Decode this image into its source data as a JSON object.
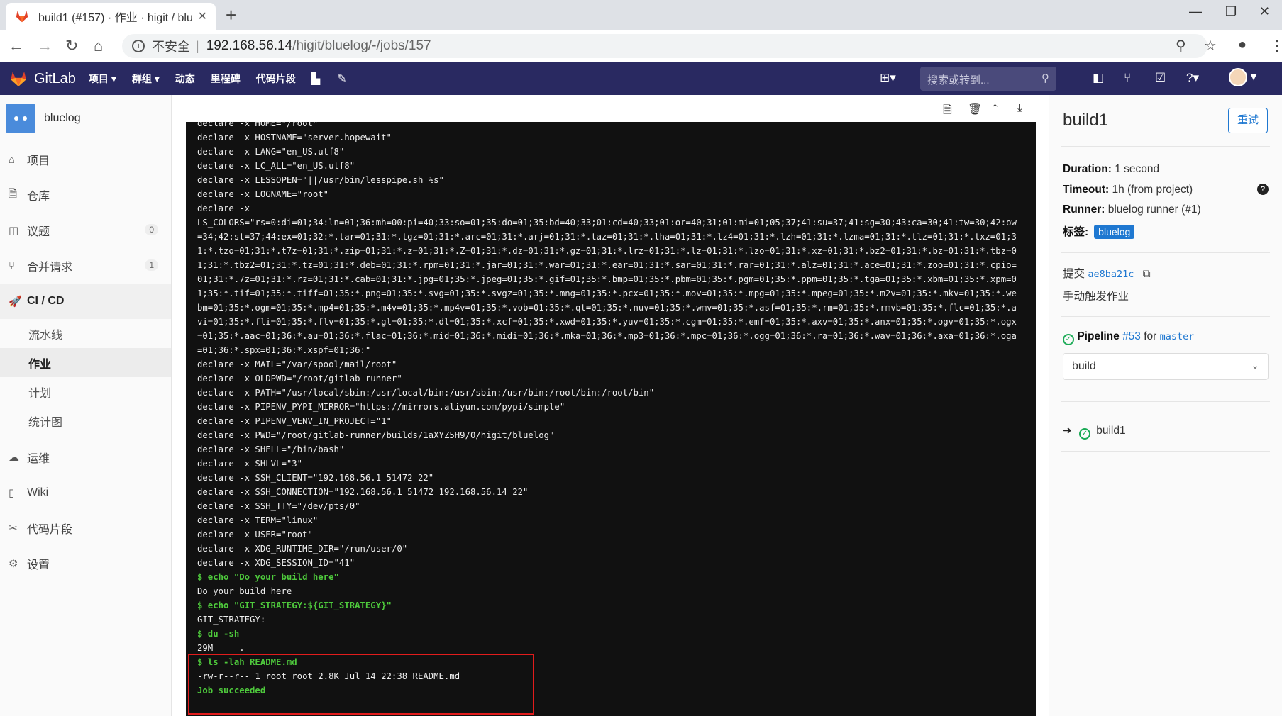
{
  "browser": {
    "tab_title": "build1 (#157) · 作业 · higit / blu",
    "url_insecure": "不安全",
    "url_host": "192.168.56.14",
    "url_path": "/higit/bluelog/-/jobs/157"
  },
  "header": {
    "brand": "GitLab",
    "nav": [
      "项目 ▾",
      "群组 ▾",
      "动态",
      "里程碑",
      "代码片段"
    ],
    "search_placeholder": "搜索或转到..."
  },
  "sidebar": {
    "project": "bluelog",
    "items": [
      {
        "label": "项目",
        "icon": "home-icon"
      },
      {
        "label": "仓库",
        "icon": "doc-icon"
      },
      {
        "label": "议题",
        "icon": "issues-icon",
        "count": "0"
      },
      {
        "label": "合并请求",
        "icon": "merge-icon",
        "count": "1"
      },
      {
        "label": "CI / CD",
        "icon": "rocket-icon"
      },
      {
        "label": "运维",
        "icon": "cloud-icon"
      },
      {
        "label": "Wiki",
        "icon": "book-icon"
      },
      {
        "label": "代码片段",
        "icon": "scissors-icon"
      },
      {
        "label": "设置",
        "icon": "gear-icon"
      }
    ],
    "cicd_sub": [
      "流水线",
      "作业",
      "计划",
      "统计图"
    ]
  },
  "log": {
    "lines": [
      {
        "t": "declare -x HOME=\"/root\"",
        "c": "w"
      },
      {
        "t": "declare -x HOSTNAME=\"server.hopewait\"",
        "c": "w"
      },
      {
        "t": "declare -x LANG=\"en_US.utf8\"",
        "c": "w"
      },
      {
        "t": "declare -x LC_ALL=\"en_US.utf8\"",
        "c": "w"
      },
      {
        "t": "declare -x LESSOPEN=\"||/usr/bin/lesspipe.sh %s\"",
        "c": "w"
      },
      {
        "t": "declare -x LOGNAME=\"root\"",
        "c": "w"
      },
      {
        "t": "declare -x",
        "c": "w"
      },
      {
        "t": "LS_COLORS=\"rs=0:di=01;34:ln=01;36:mh=00:pi=40;33:so=01;35:do=01;35:bd=40;33;01:cd=40;33;01:or=40;31;01:mi=01;05;37;41:su=37;41:sg=30;43:ca=30;41:tw=30;42:ow",
        "c": "w"
      },
      {
        "t": "=34;42:st=37;44:ex=01;32:*.tar=01;31:*.tgz=01;31:*.arc=01;31:*.arj=01;31:*.taz=01;31:*.lha=01;31:*.lz4=01;31:*.lzh=01;31:*.lzma=01;31:*.tlz=01;31:*.txz=01;3",
        "c": "w"
      },
      {
        "t": "1:*.tzo=01;31:*.t7z=01;31:*.zip=01;31:*.z=01;31:*.Z=01;31:*.dz=01;31:*.gz=01;31:*.lrz=01;31:*.lz=01;31:*.lzo=01;31:*.xz=01;31:*.bz2=01;31:*.bz=01;31:*.tbz=0",
        "c": "w"
      },
      {
        "t": "1;31:*.tbz2=01;31:*.tz=01;31:*.deb=01;31:*.rpm=01;31:*.jar=01;31:*.war=01;31:*.ear=01;31:*.sar=01;31:*.rar=01;31:*.alz=01;31:*.ace=01;31:*.zoo=01;31:*.cpio=",
        "c": "w"
      },
      {
        "t": "01;31:*.7z=01;31:*.rz=01;31:*.cab=01;31:*.jpg=01;35:*.jpeg=01;35:*.gif=01;35:*.bmp=01;35:*.pbm=01;35:*.pgm=01;35:*.ppm=01;35:*.tga=01;35:*.xbm=01;35:*.xpm=0",
        "c": "w"
      },
      {
        "t": "1;35:*.tif=01;35:*.tiff=01;35:*.png=01;35:*.svg=01;35:*.svgz=01;35:*.mng=01;35:*.pcx=01;35:*.mov=01;35:*.mpg=01;35:*.mpeg=01;35:*.m2v=01;35:*.mkv=01;35:*.we",
        "c": "w"
      },
      {
        "t": "bm=01;35:*.ogm=01;35:*.mp4=01;35:*.m4v=01;35:*.mp4v=01;35:*.vob=01;35:*.qt=01;35:*.nuv=01;35:*.wmv=01;35:*.asf=01;35:*.rm=01;35:*.rmvb=01;35:*.flc=01;35:*.a",
        "c": "w"
      },
      {
        "t": "vi=01;35:*.fli=01;35:*.flv=01;35:*.gl=01;35:*.dl=01;35:*.xcf=01;35:*.xwd=01;35:*.yuv=01;35:*.cgm=01;35:*.emf=01;35:*.axv=01;35:*.anx=01;35:*.ogv=01;35:*.ogx",
        "c": "w"
      },
      {
        "t": "=01;35:*.aac=01;36:*.au=01;36:*.flac=01;36:*.mid=01;36:*.midi=01;36:*.mka=01;36:*.mp3=01;36:*.mpc=01;36:*.ogg=01;36:*.ra=01;36:*.wav=01;36:*.axa=01;36:*.oga",
        "c": "w"
      },
      {
        "t": "=01;36:*.spx=01;36:*.xspf=01;36:\"",
        "c": "w"
      },
      {
        "t": "declare -x MAIL=\"/var/spool/mail/root\"",
        "c": "w"
      },
      {
        "t": "declare -x OLDPWD=\"/root/gitlab-runner\"",
        "c": "w"
      },
      {
        "t": "declare -x PATH=\"/usr/local/sbin:/usr/local/bin:/usr/sbin:/usr/bin:/root/bin:/root/bin\"",
        "c": "w"
      },
      {
        "t": "declare -x PIPENV_PYPI_MIRROR=\"https://mirrors.aliyun.com/pypi/simple\"",
        "c": "w"
      },
      {
        "t": "declare -x PIPENV_VENV_IN_PROJECT=\"1\"",
        "c": "w"
      },
      {
        "t": "declare -x PWD=\"/root/gitlab-runner/builds/1aXYZ5H9/0/higit/bluelog\"",
        "c": "w"
      },
      {
        "t": "declare -x SHELL=\"/bin/bash\"",
        "c": "w"
      },
      {
        "t": "declare -x SHLVL=\"3\"",
        "c": "w"
      },
      {
        "t": "declare -x SSH_CLIENT=\"192.168.56.1 51472 22\"",
        "c": "w"
      },
      {
        "t": "declare -x SSH_CONNECTION=\"192.168.56.1 51472 192.168.56.14 22\"",
        "c": "w"
      },
      {
        "t": "declare -x SSH_TTY=\"/dev/pts/0\"",
        "c": "w"
      },
      {
        "t": "declare -x TERM=\"linux\"",
        "c": "w"
      },
      {
        "t": "declare -x USER=\"root\"",
        "c": "w"
      },
      {
        "t": "declare -x XDG_RUNTIME_DIR=\"/run/user/0\"",
        "c": "w"
      },
      {
        "t": "declare -x XDG_SESSION_ID=\"41\"",
        "c": "w"
      },
      {
        "t": "$ echo \"Do your build here\"",
        "c": "g"
      },
      {
        "t": "Do your build here",
        "c": "w"
      },
      {
        "t": "$ echo \"GIT_STRATEGY:${GIT_STRATEGY}\"",
        "c": "g"
      },
      {
        "t": "GIT_STRATEGY:",
        "c": "w"
      },
      {
        "t": "$ du -sh",
        "c": "g"
      },
      {
        "t": "29M     .",
        "c": "w"
      },
      {
        "t": "$ ls -lah README.md",
        "c": "g"
      },
      {
        "t": "-rw-r--r-- 1 root root 2.8K Jul 14 22:38 README.md",
        "c": "w"
      },
      {
        "t": "Job succeeded",
        "c": "g"
      }
    ]
  },
  "job": {
    "title": "build1",
    "retry": "重试",
    "duration_label": "Duration:",
    "duration": "1 second",
    "timeout_label": "Timeout:",
    "timeout": "1h (from project)",
    "runner_label": "Runner:",
    "runner": "bluelog runner (#1)",
    "tags_label": "标签:",
    "tag": "bluelog",
    "commit_label": "提交",
    "commit_sha": "ae8ba21c",
    "commit_msg": "手动触发作业",
    "pipeline_label": "Pipeline",
    "pipeline_id": "#53",
    "pipeline_for": "for",
    "branch": "master",
    "stage": "build",
    "job_link": "build1"
  },
  "colors": {
    "header_bg": "#292961",
    "accent": "#1f78d1",
    "success": "#1aaa55",
    "log_bg": "#111111",
    "highlight_box": "#e21c1c"
  }
}
